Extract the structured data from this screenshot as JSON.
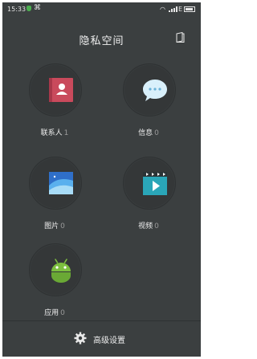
{
  "status_bar": {
    "time": "15:33",
    "network": "E",
    "icons": [
      "shield-icon",
      "usb-icon",
      "wifi-icon",
      "signal-icon",
      "battery-icon"
    ]
  },
  "header": {
    "title": "隐私空间",
    "action_icon": "notebook-icon"
  },
  "items": [
    {
      "label": "联系人",
      "count": "1",
      "icon": "contacts-icon"
    },
    {
      "label": "信息",
      "count": "0",
      "icon": "message-icon"
    },
    {
      "label": "图片",
      "count": "0",
      "icon": "picture-icon"
    },
    {
      "label": "视频",
      "count": "0",
      "icon": "video-icon"
    },
    {
      "label": "应用",
      "count": "0",
      "icon": "android-icon"
    }
  ],
  "footer": {
    "settings_label": "高级设置",
    "icon": "gear-icon"
  },
  "colors": {
    "background": "#3b3f40",
    "circle": "#343738",
    "count_text": "#9a9a9a"
  }
}
